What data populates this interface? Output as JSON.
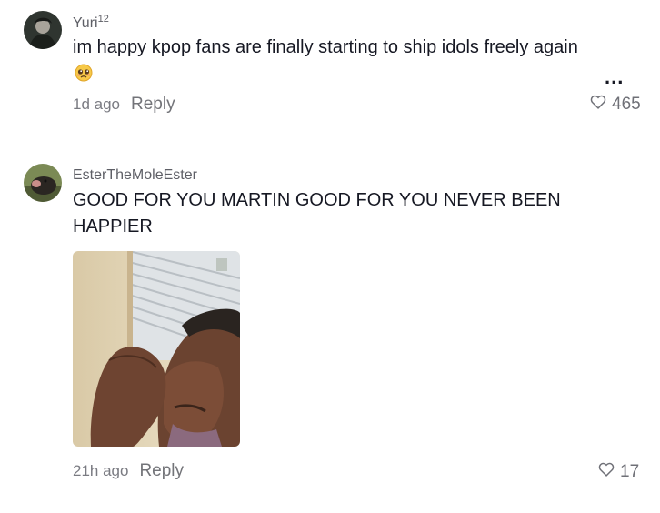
{
  "comments": [
    {
      "username": "Yuri",
      "username_suffix": "12",
      "text": "im happy kpop fans are finally starting to ship idols freely again",
      "emoji": "pleading-face-emoji",
      "time": "1d ago",
      "reply_label": "Reply",
      "likes": "465",
      "more_label": "..."
    },
    {
      "username": "EsterTheMoleEster",
      "text": "GOOD FOR YOU MARTIN GOOD FOR YOU NEVER BEEN HAPPIER",
      "attachment": "crying-woman-photo",
      "time": "21h ago",
      "reply_label": "Reply",
      "likes": "17"
    }
  ]
}
